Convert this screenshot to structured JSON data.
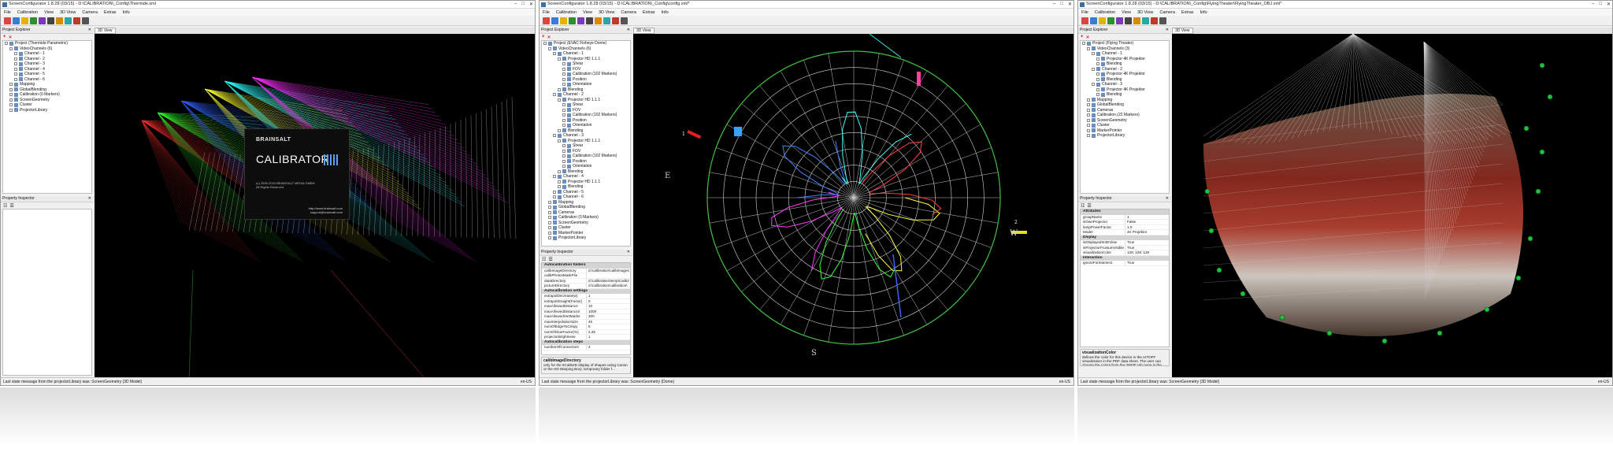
{
  "windows": [
    {
      "title": "ScreenConfigurator 1.8.28 (03/15) - D:\\CALIBRATION\\_Config\\Thermide.xml",
      "menu": [
        "File",
        "Calibration",
        "View",
        "3D View",
        "Camera",
        "Extras",
        "Info"
      ],
      "explorer_title": "Project Explorer",
      "tab": "3D View",
      "tree": [
        {
          "d": 0,
          "t": "Project (Thermide Parametric)"
        },
        {
          "d": 1,
          "t": "VideoChannels (6)"
        },
        {
          "d": 2,
          "t": "Channel - 1"
        },
        {
          "d": 2,
          "t": "Channel - 2"
        },
        {
          "d": 2,
          "t": "Channel - 3"
        },
        {
          "d": 2,
          "t": "Channel - 4"
        },
        {
          "d": 2,
          "t": "Channel - 5"
        },
        {
          "d": 2,
          "t": "Channel - 6"
        },
        {
          "d": 1,
          "t": "Mapping"
        },
        {
          "d": 1,
          "t": "GlobalBlending"
        },
        {
          "d": 1,
          "t": "Calibration (0 Markers)"
        },
        {
          "d": 1,
          "t": "ScreenGeometry"
        },
        {
          "d": 1,
          "t": "Cluster"
        },
        {
          "d": 1,
          "t": "ProjectorLibrary"
        }
      ],
      "inspector_title": "Property Inspector",
      "status": "Last state message from the projectorLibrary was: ScreenGeometry (3D Model)",
      "locale": "en-US"
    },
    {
      "title": "ScreenConfigurator 1.8.28 (03/15) - D:\\CALIBRATION\\_Config\\config.xml*",
      "menu": [
        "File",
        "Calibration",
        "View",
        "3D View",
        "Camera",
        "Extras",
        "Info"
      ],
      "explorer_title": "Project Explorer",
      "tab": "3D View",
      "tree": [
        {
          "d": 0,
          "t": "Project (EVAC Fisheye Dome)"
        },
        {
          "d": 1,
          "t": "VideoChannels (6)"
        },
        {
          "d": 2,
          "t": "Channel - 1"
        },
        {
          "d": 3,
          "t": "Projector HD 1.1.1"
        },
        {
          "d": 4,
          "t": "Shear"
        },
        {
          "d": 4,
          "t": "FOV"
        },
        {
          "d": 4,
          "t": "Calibration (102 Markers)"
        },
        {
          "d": 4,
          "t": "Position"
        },
        {
          "d": 4,
          "t": "Orientation"
        },
        {
          "d": 3,
          "t": "Blending"
        },
        {
          "d": 2,
          "t": "Channel - 2"
        },
        {
          "d": 3,
          "t": "Projector HD 1.1.1"
        },
        {
          "d": 4,
          "t": "Shear"
        },
        {
          "d": 4,
          "t": "FOV"
        },
        {
          "d": 4,
          "t": "Calibration (102 Markers)"
        },
        {
          "d": 4,
          "t": "Position"
        },
        {
          "d": 4,
          "t": "Orientation"
        },
        {
          "d": 3,
          "t": "Blending"
        },
        {
          "d": 2,
          "t": "Channel - 3"
        },
        {
          "d": 3,
          "t": "Projector HD 1.1.1"
        },
        {
          "d": 4,
          "t": "Shear"
        },
        {
          "d": 4,
          "t": "FOV"
        },
        {
          "d": 4,
          "t": "Calibration (102 Markers)"
        },
        {
          "d": 4,
          "t": "Position"
        },
        {
          "d": 4,
          "t": "Orientation"
        },
        {
          "d": 3,
          "t": "Blending"
        },
        {
          "d": 2,
          "t": "Channel - 4"
        },
        {
          "d": 3,
          "t": "Projector HD 1.1.1"
        },
        {
          "d": 3,
          "t": "Blending"
        },
        {
          "d": 2,
          "t": "Channel - 5"
        },
        {
          "d": 2,
          "t": "Channel - 6"
        },
        {
          "d": 1,
          "t": "Mapping"
        },
        {
          "d": 1,
          "t": "GlobalBlending"
        },
        {
          "d": 1,
          "t": "Cameras"
        },
        {
          "d": 1,
          "t": "Calibration (0 Markers)"
        },
        {
          "d": 1,
          "t": "ScreenGeometry"
        },
        {
          "d": 1,
          "t": "Cluster"
        },
        {
          "d": 1,
          "t": "MarkerPointer"
        },
        {
          "d": 1,
          "t": "ProjectorLibrary"
        }
      ],
      "inspector_title": "Property Inspector",
      "inspector": [
        {
          "cat": "Autocalibration folders"
        },
        {
          "k": "calibImageDirectory",
          "v": "d:\\calibration\\calibImages"
        },
        {
          "k": "calibPhotosMaskFile",
          "v": ""
        },
        {
          "k": "dataDirectory",
          "v": "d:\\calibration\\temp\\Calib2"
        },
        {
          "k": "pictureDirectory",
          "v": "d:\\calibration\\calibration\\"
        },
        {
          "cat": "Autocalibration settings"
        },
        {
          "k": "extrapolDecrease(w)",
          "v": "1"
        },
        {
          "k": "extrapolStraight(Factor)",
          "v": "0"
        },
        {
          "k": "maxAllowedDistance",
          "v": "10"
        },
        {
          "k": "maxAllowedDistance2",
          "v": "1000"
        },
        {
          "k": "maxAllowedVertMarks",
          "v": "300"
        },
        {
          "k": "maxInterpolationSize",
          "v": "45"
        },
        {
          "k": "numOfEdgeToCrispy",
          "v": "5"
        },
        {
          "k": "numOfGlueFactor(%)",
          "v": "2.25"
        },
        {
          "k": "projectorBrightness",
          "v": "1"
        },
        {
          "cat": "Autocalibration steps"
        },
        {
          "k": "numberOfConnectors",
          "v": "4"
        }
      ],
      "desc_title": "calibImageDirectory",
      "desc": "only for the ItCalib2D display of shapes using Canon or the HD Warping Box): temporary folder f...",
      "status": "Last state message from the projectorLibrary was: ScreenGeometry (Dome)",
      "locale": "en-US",
      "compass": {
        "n": "S",
        "e": "E",
        "w": "W"
      },
      "markers": {
        "one": "1",
        "two": "2"
      }
    },
    {
      "title": "ScreenConfigurator 1.8.28 (03/15) - D:\\CALIBRATION\\_Config\\FlyingTheater\\FlyingTheater_OBJ.xml*",
      "menu": [
        "File",
        "Calibration",
        "View",
        "3D View",
        "Camera",
        "Extras",
        "Info"
      ],
      "explorer_title": "Project Explorer",
      "tab": "3D View",
      "tree": [
        {
          "d": 0,
          "t": "Project (Flying Theater)"
        },
        {
          "d": 1,
          "t": "VideoChannels (3)"
        },
        {
          "d": 2,
          "t": "Channel - 1"
        },
        {
          "d": 3,
          "t": "Projector 4K Projektor"
        },
        {
          "d": 3,
          "t": "Blending"
        },
        {
          "d": 2,
          "t": "Channel - 2"
        },
        {
          "d": 3,
          "t": "Projector 4K Projektor"
        },
        {
          "d": 3,
          "t": "Blending"
        },
        {
          "d": 2,
          "t": "Channel - 3"
        },
        {
          "d": 3,
          "t": "Projector 4K Projektor"
        },
        {
          "d": 3,
          "t": "Blending"
        },
        {
          "d": 1,
          "t": "Mapping"
        },
        {
          "d": 1,
          "t": "GlobalBlending"
        },
        {
          "d": 1,
          "t": "Cameras"
        },
        {
          "d": 1,
          "t": "Calibration (22 Markers)"
        },
        {
          "d": 1,
          "t": "ScreenGeometry"
        },
        {
          "d": 1,
          "t": "Cluster"
        },
        {
          "d": 1,
          "t": "MarkerPointer"
        },
        {
          "d": 1,
          "t": "ProjectorLibrary"
        }
      ],
      "inspector_title": "Property Inspector",
      "inspector": [
        {
          "cat": "Attributes"
        },
        {
          "k": "groupName",
          "v": "1"
        },
        {
          "k": "isOwnProjector",
          "v": "False"
        },
        {
          "k": "lampPowerFactor",
          "v": "1.0"
        },
        {
          "k": "Model",
          "v": "4K Projektor"
        },
        {
          "cat": "Display"
        },
        {
          "k": "isDisplayedIn3DView",
          "v": "True"
        },
        {
          "k": "isProjectorFrustumVisible",
          "v": "True"
        },
        {
          "k": "visualizationColor",
          "v": "128; 128; 128"
        },
        {
          "cat": "Interaction"
        },
        {
          "k": "ignoreForIntersect",
          "v": "True"
        }
      ],
      "desc_title": "visualizationColor",
      "desc": "defines the color for this device in the ArTOFF visualization in the PDF data sheet. The user can choose the colors from the \"WEB\" tab page in the color...",
      "status": "Last state message from the projectorLibrary was: ScreenGeometry (3D Model)",
      "locale": "en-US"
    }
  ],
  "splash": {
    "brand": "BRAINSALT",
    "product": "CALIBRATOR",
    "copyright": "(c) 2005-2015 BRAINSALT MEDIA GMBH\nAll Rights Reserved",
    "web": "http://www.brainsalt.com\nsupport@brainsalt.com"
  },
  "colors": {
    "toolbar_icons": [
      "#d44",
      "#3a7bd5",
      "#e2b400",
      "#2f8f2f",
      "#7a3ab8",
      "#444",
      "#d88a00",
      "#2aa6a6",
      "#c0392b",
      "#555"
    ]
  }
}
